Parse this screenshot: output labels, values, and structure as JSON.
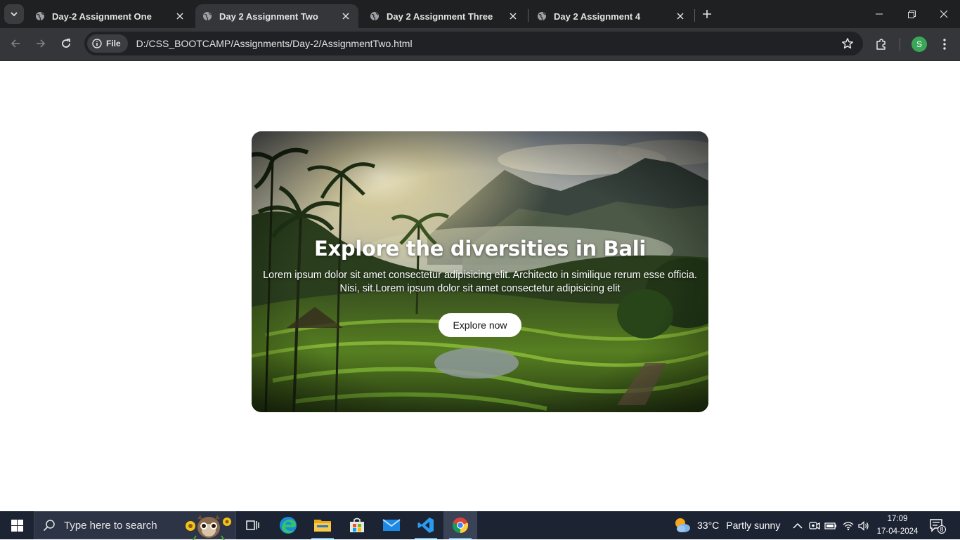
{
  "browser": {
    "tabs": [
      {
        "title": "Day-2 Assignment One",
        "active": false
      },
      {
        "title": "Day 2 Assignment Two",
        "active": true
      },
      {
        "title": "Day 2 Assignment Three",
        "active": false
      },
      {
        "title": "Day 2 Assignment 4",
        "active": false
      }
    ],
    "site_chip_label": "File",
    "url": "D:/CSS_BOOTCAMP/Assignments/Day-2/AssignmentTwo.html",
    "profile_initial": "S",
    "colors": {
      "frame": "#1f2022",
      "toolbar": "#35363a",
      "omnibox": "#202124",
      "profile": "#3aa757"
    }
  },
  "page": {
    "card": {
      "title": "Explore the diversities in Bali",
      "text": "Lorem ipsum dolor sit amet consectetur adipisicing elit. Architecto in similique rerum esse officia. Nisi, sit.Lorem ipsum dolor sit amet consectetur adipisicing elit",
      "button_label": "Explore now",
      "image": "bali-rice-terraces-landscape"
    }
  },
  "taskbar": {
    "search_placeholder": "Type here to search",
    "apps": [
      "task-view",
      "edge",
      "file-explorer",
      "microsoft-store",
      "mail",
      "vscode",
      "chrome"
    ],
    "weather": {
      "temp": "33°C",
      "desc": "Partly sunny"
    },
    "time": "17:09",
    "date": "17-04-2024",
    "notifications": "8",
    "colors": {
      "bar": "#1c2433",
      "accent": "#76b9ed"
    }
  }
}
